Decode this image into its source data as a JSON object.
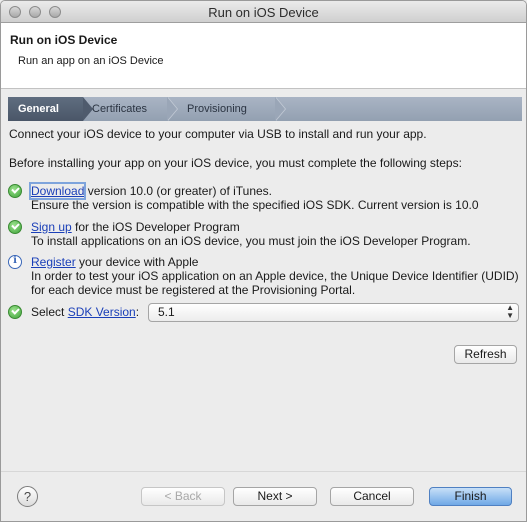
{
  "window": {
    "title": "Run on iOS Device"
  },
  "header": {
    "title": "Run on iOS Device",
    "subtitle": "Run an app on an iOS Device"
  },
  "tabs": [
    {
      "label": "General",
      "active": true
    },
    {
      "label": "Certificates",
      "active": false
    },
    {
      "label": "Provisioning",
      "active": false
    }
  ],
  "intro": {
    "line1": "Connect your iOS device to your computer via USB to install and run your app.",
    "line2": "Before installing your app on your iOS device, you must complete the following steps:"
  },
  "steps": [
    {
      "status": "check-icon",
      "link": "Download",
      "text": " version 10.0 (or greater) of iTunes.",
      "detail": "Ensure the version is compatible with the specified iOS SDK. Current version is 10.0"
    },
    {
      "status": "check-icon",
      "link": "Sign up",
      "text": " for the iOS Developer Program",
      "detail": "To install applications on an iOS device, you must join the iOS Developer Program."
    },
    {
      "status": "info-icon",
      "link": "Register",
      "text": " your device with Apple",
      "detail": "In order to test your iOS application on an Apple device, the Unique Device Identifier (UDID)",
      "detail2": "for each device must be registered at the Provisioning Portal."
    },
    {
      "status": "check-icon",
      "prefix": "Select ",
      "link": "SDK Version",
      "text": ":"
    }
  ],
  "sdk_select": {
    "value": "5.1"
  },
  "buttons": {
    "refresh": "Refresh",
    "help": "?",
    "back": "< Back",
    "next": "Next >",
    "cancel": "Cancel",
    "finish": "Finish"
  },
  "colors": {
    "link": "#1a3fb8",
    "active_tab": "#4a5668",
    "finish_button": "#6fa8e6",
    "ok_status": "#3fa33a",
    "info_status": "#3a67b8"
  }
}
